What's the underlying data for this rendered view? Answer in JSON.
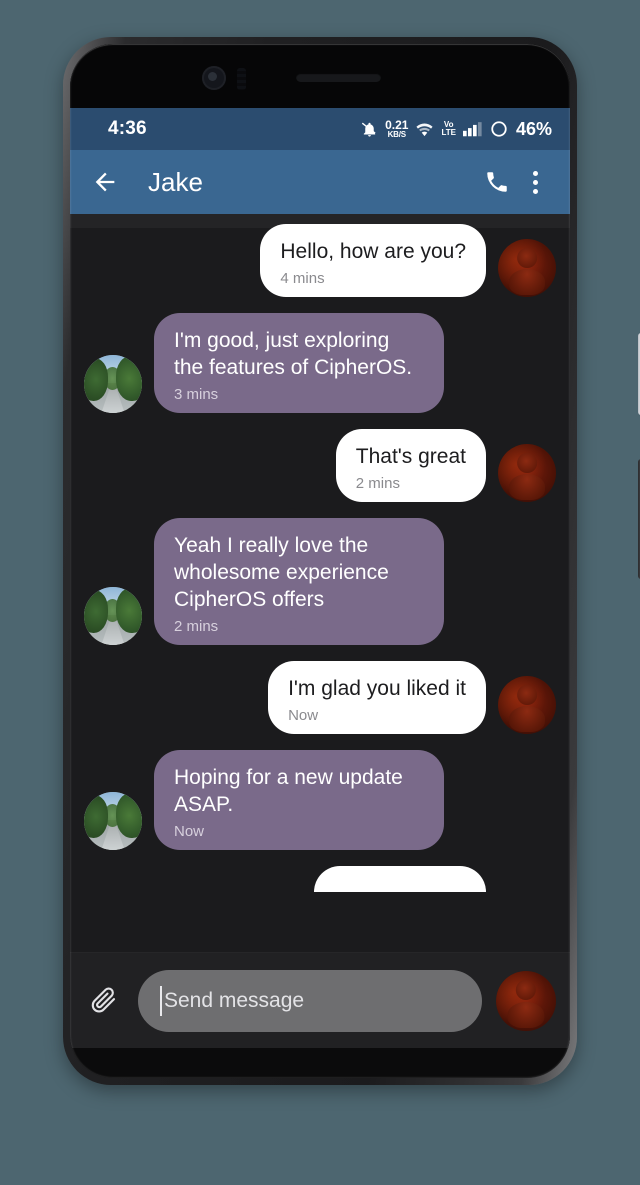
{
  "status_bar": {
    "time": "4:36",
    "data_rate_value": "0.21",
    "data_rate_unit": "KB/S",
    "volte_top": "Vo",
    "volte_bottom": "LTE",
    "battery_percent": "46%",
    "icons": [
      "notification-muted-icon",
      "data-rate-icon",
      "wifi-icon",
      "volte-icon",
      "cellular-signal-icon",
      "battery-icon"
    ]
  },
  "app_bar": {
    "back_label": "back-arrow",
    "title": "Jake",
    "call_label": "call",
    "menu_label": "more-options",
    "background_color": "#3a6791"
  },
  "conversation": {
    "messages": [
      {
        "text": "Hello, how are you?",
        "time": "4 mins",
        "direction": "sent",
        "avatar": "person-red"
      },
      {
        "text": "I'm good, just exploring the features of CipherOS.",
        "time": "3 mins",
        "direction": "received",
        "avatar": "street-photo"
      },
      {
        "text": "That's great",
        "time": "2 mins",
        "direction": "sent",
        "avatar": "person-red"
      },
      {
        "text": "Yeah I really love the wholesome experience CipherOS offers",
        "time": "2 mins",
        "direction": "received",
        "avatar": "street-photo"
      },
      {
        "text": "I'm glad you liked it",
        "time": "Now",
        "direction": "sent",
        "avatar": "person-red"
      },
      {
        "text": "Hoping for a new update ASAP.",
        "time": "Now",
        "direction": "received",
        "avatar": "street-photo"
      }
    ],
    "bubble_sent_color": "#ffffff",
    "bubble_received_color": "#7a6a8a",
    "background_color": "#1b1b1d"
  },
  "input_bar": {
    "attach_label": "attach-file",
    "placeholder": "Send message",
    "value": "",
    "send_avatar_label": "profile-avatar"
  }
}
